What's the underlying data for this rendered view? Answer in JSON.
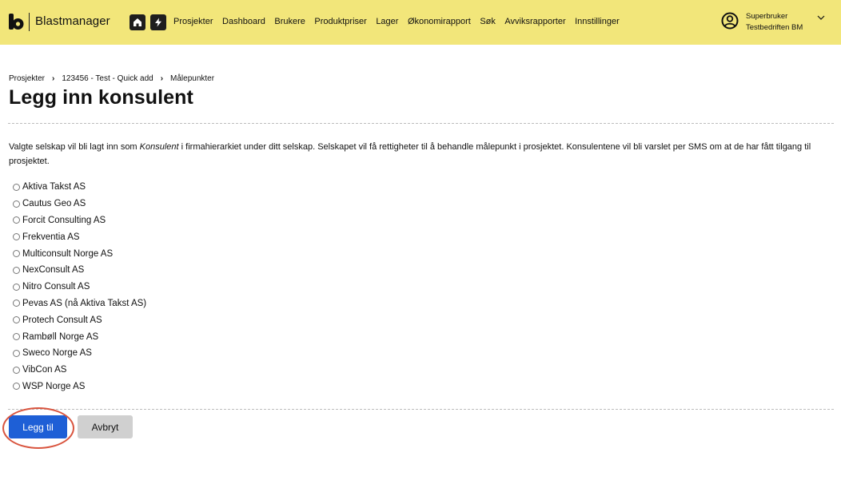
{
  "header": {
    "brand": "Blastmanager",
    "nav": [
      "Prosjekter",
      "Dashboard",
      "Brukere",
      "Produktpriser",
      "Lager",
      "Økonomirapport",
      "Søk",
      "Avviksrapporter",
      "Innstillinger"
    ],
    "user": {
      "name": "Superbruker",
      "company": "Testbedriften BM"
    },
    "icons": {
      "home": "home-icon",
      "bolt": "lightning-icon",
      "user": "user-circle-icon",
      "chevron": "chevron-down-icon"
    }
  },
  "breadcrumb": [
    "Prosjekter",
    "123456 - Test - Quick add",
    "Målepunkter"
  ],
  "page": {
    "title": "Legg inn konsulent",
    "intro_before": "Valgte selskap vil bli lagt inn som ",
    "intro_emphasis": "Konsulent",
    "intro_after": " i firmahierarkiet under ditt selskap. Selskapet vil få rettigheter til å behandle målepunkt i prosjektet. Konsulentene vil bli varslet per SMS om at de har fått tilgang til prosjektet."
  },
  "companies": [
    "Aktiva Takst AS",
    "Cautus Geo AS",
    "Forcit Consulting AS",
    "Frekventia AS",
    "Multiconsult Norge AS",
    "NexConsult AS",
    "Nitro Consult AS",
    "Pevas AS (nå Aktiva Takst AS)",
    "Protech Consult AS",
    "Rambøll Norge AS",
    "Sweco Norge AS",
    "VibCon AS",
    "WSP Norge AS"
  ],
  "buttons": {
    "add": "Legg til",
    "cancel": "Avbryt"
  },
  "colors": {
    "header_bg": "#f2e67a",
    "primary": "#1e5fd6",
    "secondary": "#d0d0d0",
    "highlight": "#d9553f"
  }
}
